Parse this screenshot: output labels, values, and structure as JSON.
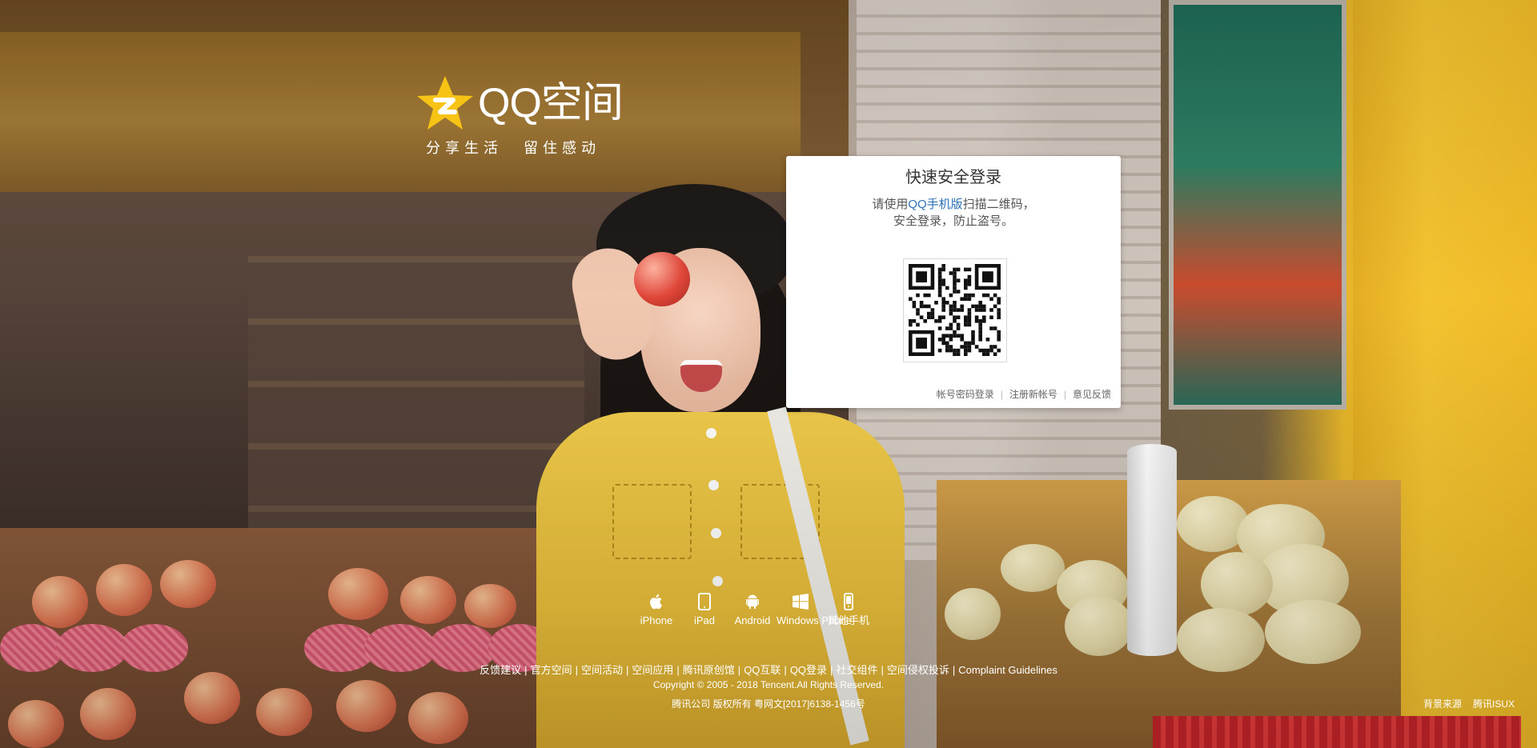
{
  "brand": {
    "name": "QQ空间",
    "slogan_left": "分享生活",
    "slogan_right": "留住感动",
    "star_color": "#f7c314"
  },
  "login": {
    "title": "快速安全登录",
    "tip_prefix": "请使用",
    "tip_link": "QQ手机版",
    "tip_suffix": "扫描二维码，",
    "tip_line2": "安全登录，防止盗号。",
    "links": [
      "帐号密码登录",
      "注册新帐号",
      "意见反馈"
    ],
    "link_color": "#2e71b7"
  },
  "platforms": [
    {
      "label": "iPhone",
      "icon": "apple-icon"
    },
    {
      "label": "iPad",
      "icon": "tablet-icon"
    },
    {
      "label": "Android",
      "icon": "android-icon"
    },
    {
      "label": "Windows Phone",
      "icon": "windows-icon"
    },
    {
      "label": "其他手机",
      "icon": "phone-icon"
    }
  ],
  "footer": {
    "links": [
      "反馈建议",
      "官方空间",
      "空间活动",
      "空间应用",
      "腾讯原创馆",
      "QQ互联",
      "QQ登录",
      "社交组件",
      "空间侵权投诉",
      "Complaint Guidelines"
    ],
    "copyright": "Copyright © 2005 - 2018 Tencent.All Rights Reserved.",
    "icp": "腾讯公司 版权所有 粤网文[2017]6138-1456号",
    "credits": [
      "背景来源",
      "腾讯ISUX"
    ]
  }
}
